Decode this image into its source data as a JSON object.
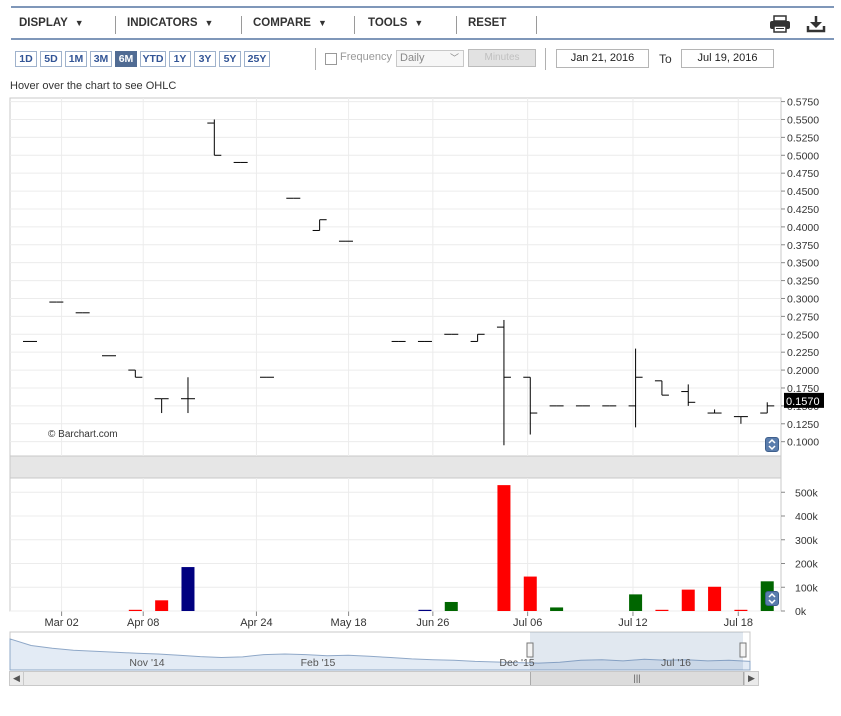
{
  "menu": {
    "display": "DISPLAY",
    "indicators": "INDICATORS",
    "compare": "COMPARE",
    "tools": "TOOLS",
    "reset": "RESET"
  },
  "ranges": [
    {
      "label": "1D",
      "active": false
    },
    {
      "label": "5D",
      "active": false
    },
    {
      "label": "1M",
      "active": false
    },
    {
      "label": "3M",
      "active": false
    },
    {
      "label": "6M",
      "active": true
    },
    {
      "label": "YTD",
      "active": false
    },
    {
      "label": "1Y",
      "active": false
    },
    {
      "label": "3Y",
      "active": false
    },
    {
      "label": "5Y",
      "active": false
    },
    {
      "label": "25Y",
      "active": false
    }
  ],
  "frequency": {
    "label": "Frequency",
    "value": "Daily",
    "minutes_label": "Minutes"
  },
  "dates": {
    "from": "Jan 21, 2016",
    "to_label": "To",
    "to": "Jul 19, 2016"
  },
  "hint": "Hover over the chart to see OHLC",
  "watermark": "© Barchart.com",
  "icons": {
    "print": "print-icon",
    "download": "download-icon"
  },
  "colors": {
    "up": "#006600",
    "down": "#ff0000",
    "neutral": "#000080",
    "accent": "#5a7dad",
    "last_price_bg": "#000000"
  },
  "chart_data": [
    {
      "type": "ohlc",
      "price_axis": {
        "ylim": [
          0.08,
          0.58
        ],
        "ticks": [
          "0.5750",
          "0.5500",
          "0.5250",
          "0.5000",
          "0.4750",
          "0.4500",
          "0.4250",
          "0.4000",
          "0.3750",
          "0.3500",
          "0.3250",
          "0.3000",
          "0.2750",
          "0.2500",
          "0.2250",
          "0.2000",
          "0.1750",
          "0.1500",
          "0.1250",
          "0.1000"
        ]
      },
      "last_price": "0.1570",
      "candles": [
        {
          "i": 0,
          "o": 0.24,
          "h": 0.24,
          "l": 0.24,
          "c": 0.24
        },
        {
          "i": 1,
          "o": 0.295,
          "h": 0.295,
          "l": 0.295,
          "c": 0.295
        },
        {
          "i": 2,
          "o": 0.28,
          "h": 0.28,
          "l": 0.28,
          "c": 0.28
        },
        {
          "i": 3,
          "o": 0.22,
          "h": 0.22,
          "l": 0.22,
          "c": 0.22
        },
        {
          "i": 4,
          "o": 0.2,
          "h": 0.2,
          "l": 0.19,
          "c": 0.19
        },
        {
          "i": 5,
          "o": 0.16,
          "h": 0.16,
          "l": 0.14,
          "c": 0.16
        },
        {
          "i": 6,
          "o": 0.16,
          "h": 0.19,
          "l": 0.14,
          "c": 0.16
        },
        {
          "i": 7,
          "o": 0.545,
          "h": 0.55,
          "l": 0.5,
          "c": 0.5
        },
        {
          "i": 8,
          "o": 0.49,
          "h": 0.49,
          "l": 0.49,
          "c": 0.49
        },
        {
          "i": 9,
          "o": 0.19,
          "h": 0.19,
          "l": 0.19,
          "c": 0.19
        },
        {
          "i": 10,
          "o": 0.44,
          "h": 0.44,
          "l": 0.44,
          "c": 0.44
        },
        {
          "i": 11,
          "o": 0.395,
          "h": 0.41,
          "l": 0.395,
          "c": 0.41
        },
        {
          "i": 12,
          "o": 0.38,
          "h": 0.38,
          "l": 0.38,
          "c": 0.38
        },
        {
          "i": 14,
          "o": 0.24,
          "h": 0.24,
          "l": 0.24,
          "c": 0.24
        },
        {
          "i": 15,
          "o": 0.24,
          "h": 0.24,
          "l": 0.24,
          "c": 0.24
        },
        {
          "i": 16,
          "o": 0.25,
          "h": 0.25,
          "l": 0.25,
          "c": 0.25
        },
        {
          "i": 17,
          "o": 0.24,
          "h": 0.25,
          "l": 0.24,
          "c": 0.25
        },
        {
          "i": 18,
          "o": 0.26,
          "h": 0.27,
          "l": 0.095,
          "c": 0.19
        },
        {
          "i": 19,
          "o": 0.19,
          "h": 0.19,
          "l": 0.11,
          "c": 0.14
        },
        {
          "i": 20,
          "o": 0.15,
          "h": 0.15,
          "l": 0.15,
          "c": 0.15
        },
        {
          "i": 21,
          "o": 0.15,
          "h": 0.15,
          "l": 0.15,
          "c": 0.15
        },
        {
          "i": 22,
          "o": 0.15,
          "h": 0.15,
          "l": 0.15,
          "c": 0.15
        },
        {
          "i": 23,
          "o": 0.15,
          "h": 0.23,
          "l": 0.12,
          "c": 0.19
        },
        {
          "i": 24,
          "o": 0.185,
          "h": 0.185,
          "l": 0.165,
          "c": 0.165
        },
        {
          "i": 25,
          "o": 0.17,
          "h": 0.18,
          "l": 0.15,
          "c": 0.155
        },
        {
          "i": 26,
          "o": 0.14,
          "h": 0.145,
          "l": 0.14,
          "c": 0.14
        },
        {
          "i": 27,
          "o": 0.135,
          "h": 0.135,
          "l": 0.125,
          "c": 0.135
        },
        {
          "i": 28,
          "o": 0.14,
          "h": 0.155,
          "l": 0.14,
          "c": 0.15
        }
      ],
      "x_ticks": [
        {
          "i": 1.2,
          "label": "Mar 02"
        },
        {
          "i": 4.3,
          "label": "Apr 08"
        },
        {
          "i": 8.6,
          "label": "Apr 24"
        },
        {
          "i": 12.1,
          "label": "May 18"
        },
        {
          "i": 15.3,
          "label": "Jun 26"
        },
        {
          "i": 18.9,
          "label": "Jul 06"
        },
        {
          "i": 22.9,
          "label": "Jul 12"
        },
        {
          "i": 26.9,
          "label": "Jul 18"
        }
      ]
    },
    {
      "type": "bar",
      "title": "volume",
      "ylim": [
        0,
        560000
      ],
      "ticks": [
        "500k",
        "400k",
        "300k",
        "200k",
        "100k",
        "0k"
      ],
      "bars": [
        {
          "i": 4,
          "v": 5000,
          "dir": "down"
        },
        {
          "i": 5,
          "v": 45000,
          "dir": "down"
        },
        {
          "i": 6,
          "v": 185000,
          "dir": "neutral"
        },
        {
          "i": 15,
          "v": 5000,
          "dir": "neutral"
        },
        {
          "i": 16,
          "v": 38000,
          "dir": "up"
        },
        {
          "i": 18,
          "v": 530000,
          "dir": "down"
        },
        {
          "i": 19,
          "v": 145000,
          "dir": "down"
        },
        {
          "i": 20,
          "v": 15000,
          "dir": "up"
        },
        {
          "i": 23,
          "v": 70000,
          "dir": "up"
        },
        {
          "i": 24,
          "v": 5000,
          "dir": "down"
        },
        {
          "i": 25,
          "v": 90000,
          "dir": "down"
        },
        {
          "i": 26,
          "v": 102000,
          "dir": "down"
        },
        {
          "i": 27,
          "v": 5000,
          "dir": "down"
        },
        {
          "i": 28,
          "v": 125000,
          "dir": "up"
        }
      ]
    }
  ],
  "navigator": {
    "labels": [
      "Nov '14",
      "Feb '15",
      "Dec '15",
      "Jul '16"
    ],
    "series": [
      0.95,
      0.72,
      0.62,
      0.55,
      0.52,
      0.48,
      0.45,
      0.42,
      0.38,
      0.33,
      0.3,
      0.32,
      0.4,
      0.42,
      0.4,
      0.36,
      0.38,
      0.34,
      0.3,
      0.25,
      0.22,
      0.2,
      0.16,
      0.14,
      0.12,
      0.1,
      0.13,
      0.2,
      0.22,
      0.18,
      0.24,
      0.2,
      0.22,
      0.18,
      0.2,
      0.16
    ],
    "scroll_grip": "|||"
  }
}
